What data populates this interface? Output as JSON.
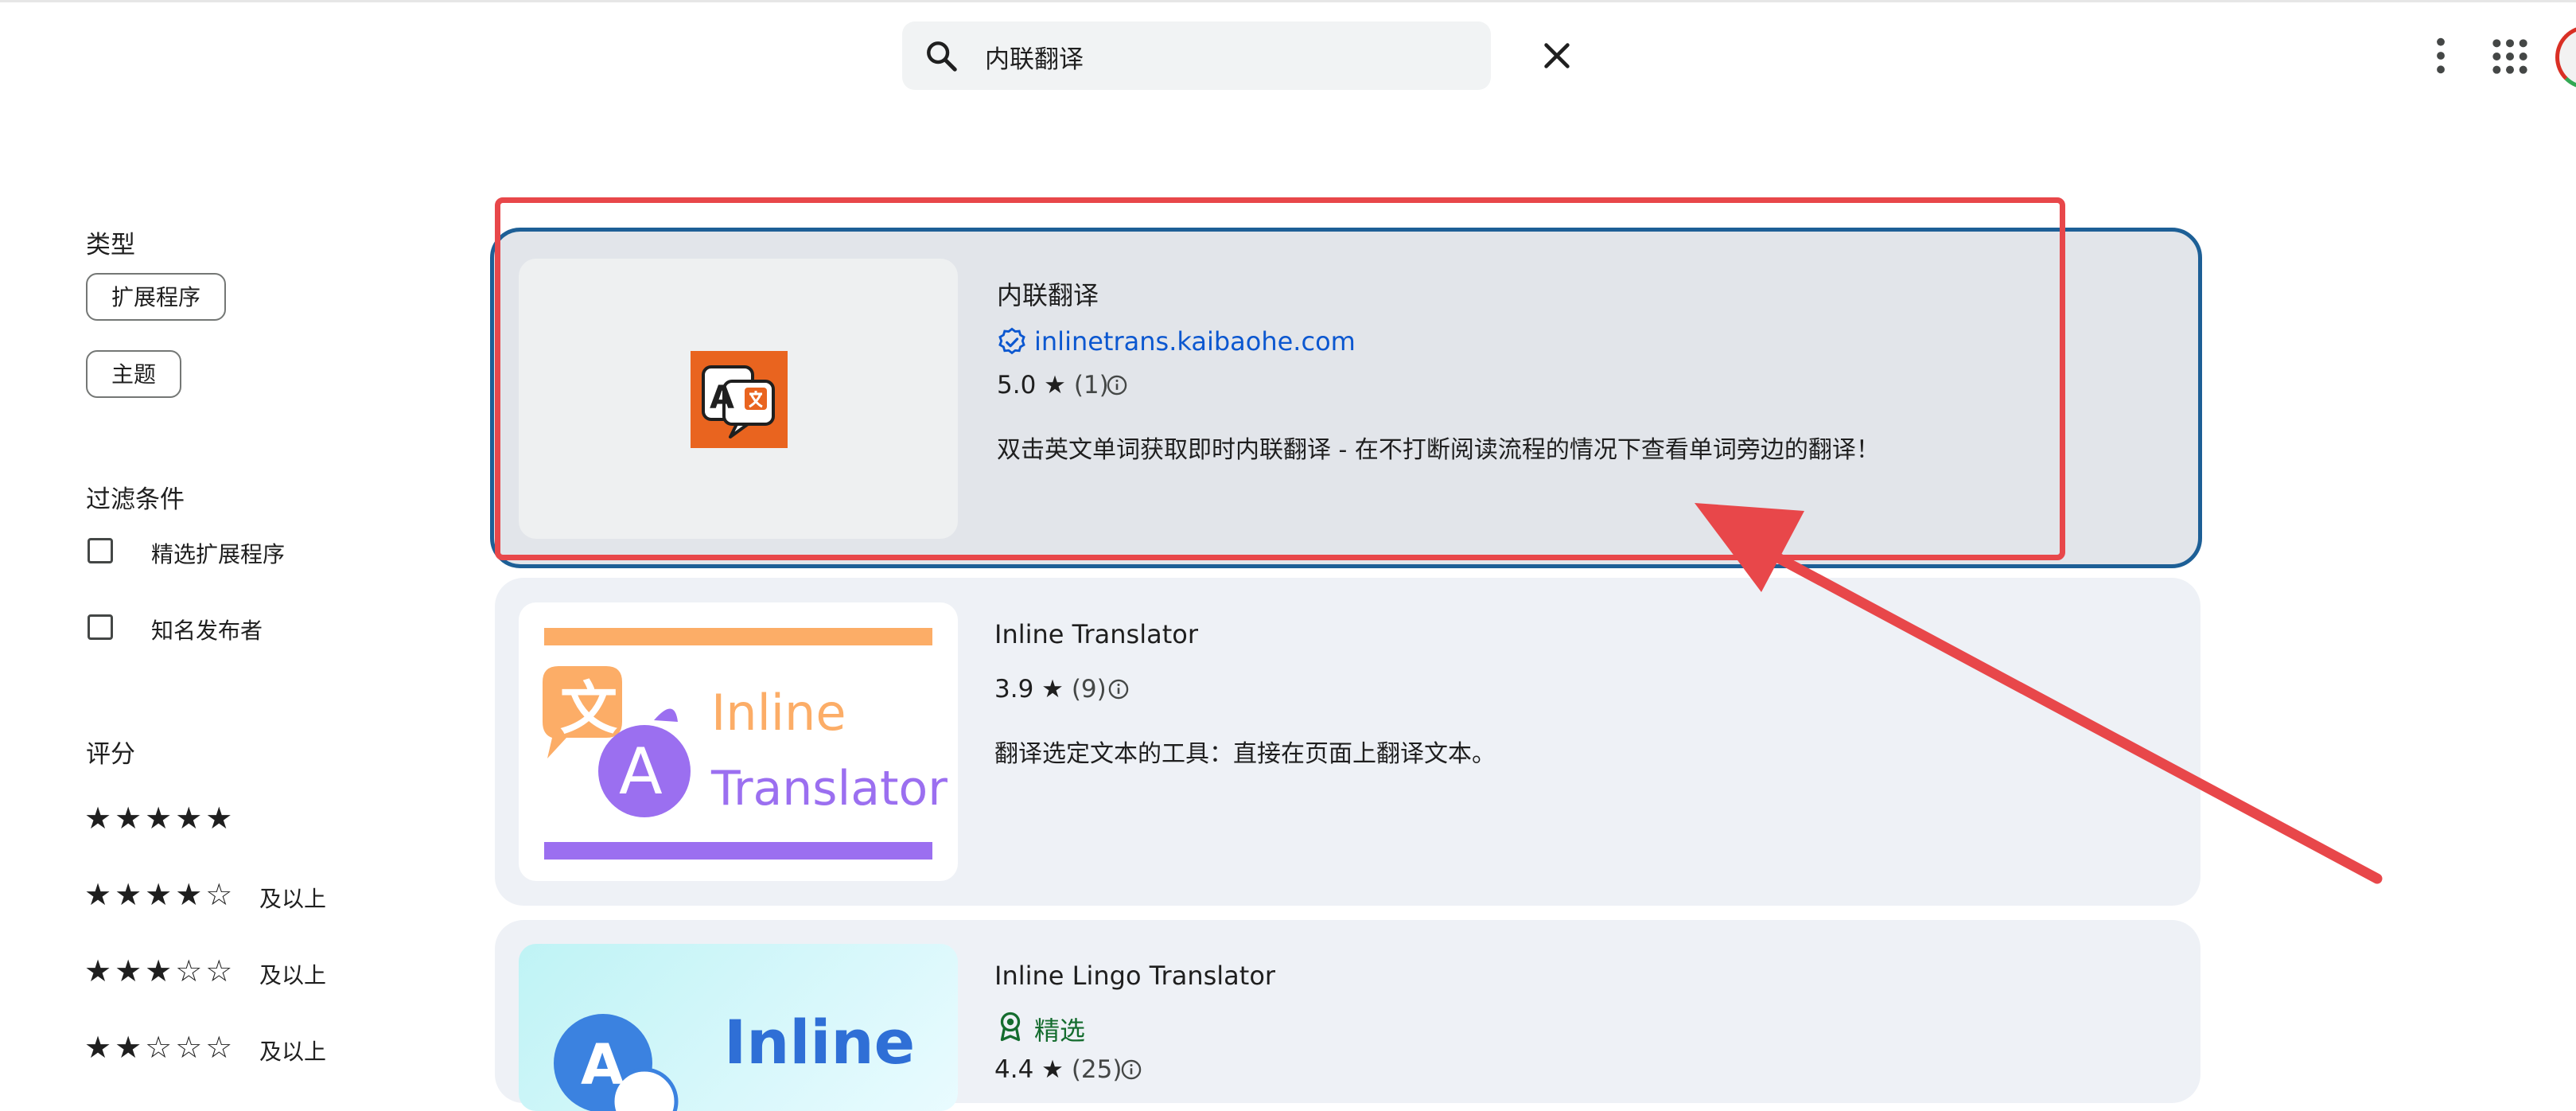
{
  "search": {
    "query": "内联翻译"
  },
  "sidebar": {
    "type_heading": "类型",
    "type_chips": [
      "扩展程序",
      "主题"
    ],
    "filter_heading": "过滤条件",
    "filters": [
      "精选扩展程序",
      "知名发布者"
    ],
    "rating_heading": "评分",
    "ratings": [
      {
        "stars": "★★★★★",
        "suffix": ""
      },
      {
        "stars": "★★★★☆",
        "suffix": "及以上"
      },
      {
        "stars": "★★★☆☆",
        "suffix": "及以上"
      },
      {
        "stars": "★★☆☆☆",
        "suffix": "及以上"
      }
    ]
  },
  "results": [
    {
      "title": "内联翻译",
      "publisher": "inlinetrans.kaibaohe.com",
      "rating": "5.0",
      "count": "(1)",
      "description": "双击英文单词获取即时内联翻译 - 在不打断阅读流程的情况下查看单词旁边的翻译！"
    },
    {
      "title": "Inline Translator",
      "rating": "3.9",
      "count": "(9)",
      "description": "翻译选定文本的工具：直接在页面上翻译文本。",
      "thumb_line1": "Inline",
      "thumb_line2": "Translator",
      "thumb_glyph1": "文",
      "thumb_glyph2": "A"
    },
    {
      "title": "Inline Lingo Translator",
      "featured_label": "精选",
      "rating": "4.4",
      "count": "(25)",
      "thumb_word": "Inline",
      "thumb_glyph": "A"
    }
  ],
  "colors": {
    "annotation_red": "#e8474a",
    "selection_blue": "#1d5f96",
    "link_blue": "#0b57d0",
    "featured_green": "#146c2e"
  },
  "icons": [
    "search-icon",
    "close-icon",
    "more-vert-icon",
    "apps-grid-icon",
    "verified-icon",
    "star-icon",
    "info-icon",
    "featured-badge-icon",
    "annotation-arrow"
  ]
}
